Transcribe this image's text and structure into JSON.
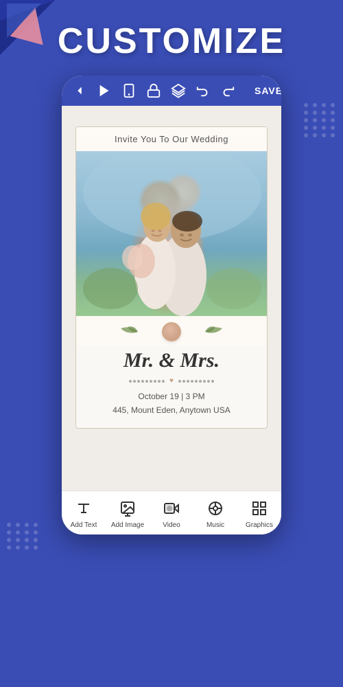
{
  "page": {
    "title": "CUSTOMIZE",
    "background_color": "#3a4db5"
  },
  "toolbar": {
    "back_label": "‹",
    "play_label": "▶",
    "device_label": "☐",
    "lock_label": "🔓",
    "layers_label": "⧉",
    "undo_label": "↩",
    "redo_label": "↪",
    "save_label": "SAVE"
  },
  "card": {
    "header_text": "Invite You To Our Wedding",
    "couple_names": "Mr. & Mrs.",
    "event_date": "October 19 | 3 PM",
    "event_location": "445, Mount Eden, Anytown USA"
  },
  "bottom_tools": [
    {
      "id": "add-text",
      "label": "Add Text",
      "icon": "T"
    },
    {
      "id": "add-image",
      "label": "Add Image",
      "icon": "img"
    },
    {
      "id": "video",
      "label": "Video",
      "icon": "vid"
    },
    {
      "id": "music",
      "label": "Music",
      "icon": "mus"
    },
    {
      "id": "graphics",
      "label": "Graphics",
      "icon": "gfx"
    }
  ]
}
